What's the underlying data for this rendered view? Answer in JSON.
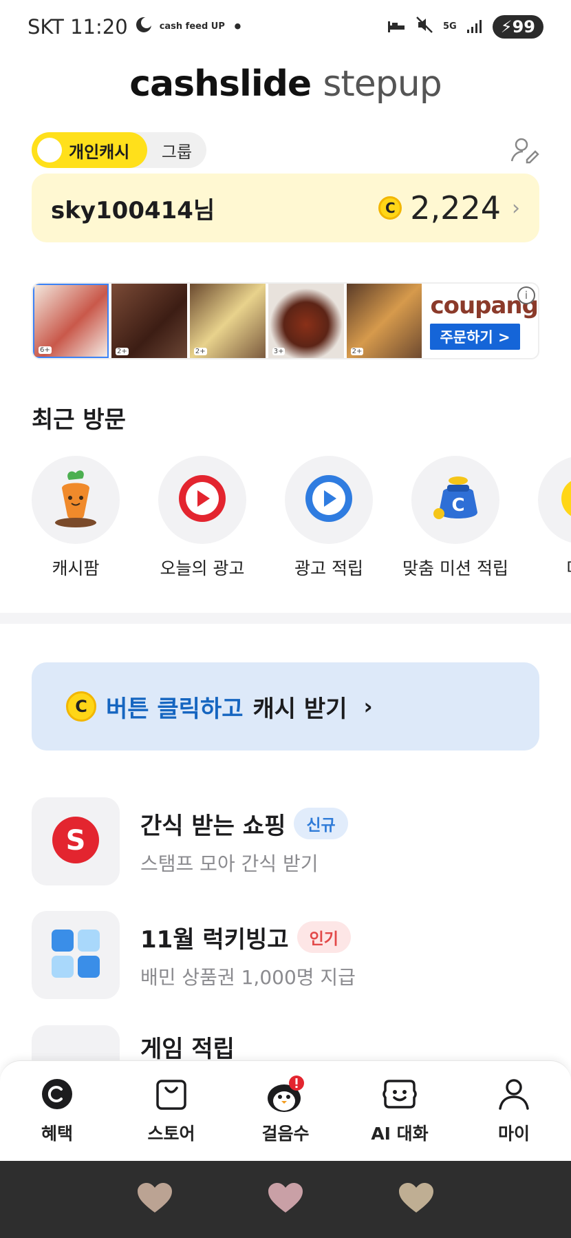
{
  "status_bar": {
    "carrier_time": "SKT 11:20",
    "app_badge": "cash feed UP",
    "dot": "•",
    "network": "5G",
    "battery": "99"
  },
  "header": {
    "title_part1": "cashslide",
    "title_part2": "stepup"
  },
  "toggle": {
    "active_label": "개인캐시",
    "inactive_label": "그룹"
  },
  "user_card": {
    "username": "sky100414님",
    "coin_symbol": "C",
    "cash_amount": "2,224"
  },
  "ad_banner": {
    "thumb_counts": [
      "6+",
      "2+",
      "2+",
      "3+",
      "2+"
    ],
    "brand": "coupang",
    "order_button": "주문하기 >",
    "info_symbol": "i"
  },
  "recent": {
    "title": "최근 방문",
    "items": [
      {
        "label": "캐시팜",
        "icon": "carrier-carrot-icon"
      },
      {
        "label": "오늘의 광고",
        "icon": "play-red-icon"
      },
      {
        "label": "광고 적립",
        "icon": "play-blue-icon"
      },
      {
        "label": "맞춤 미션 적립",
        "icon": "money-bag-icon"
      },
      {
        "label": "미션",
        "icon": "coin-icon"
      }
    ]
  },
  "cash_banner": {
    "coin_symbol": "C",
    "blue_text": "버튼 클릭하고",
    "black_text": "캐시 받기",
    "chevron": "›"
  },
  "list": [
    {
      "title": "간식 받는 쇼핑",
      "tag": "신규",
      "subtitle": "스탬프 모아 간식 받기",
      "icon_letter": "S"
    },
    {
      "title": "11월 럭키빙고",
      "tag": "인기",
      "subtitle": "배민 상품권 1,000명 지급"
    },
    {
      "title": "게임 적립"
    }
  ],
  "bottom_nav": [
    {
      "label": "혜택",
      "icon": "cash-c-icon"
    },
    {
      "label": "스토어",
      "icon": "shopping-bag-icon"
    },
    {
      "label": "걸음수",
      "icon": "penguin-icon"
    },
    {
      "label": "AI 대화",
      "icon": "smile-face-icon"
    },
    {
      "label": "마이",
      "icon": "person-icon"
    }
  ],
  "colors": {
    "accent_yellow": "#ffe01b",
    "card_yellow": "#fff8d2",
    "banner_blue": "#dde9f9",
    "link_blue": "#1565c0"
  }
}
